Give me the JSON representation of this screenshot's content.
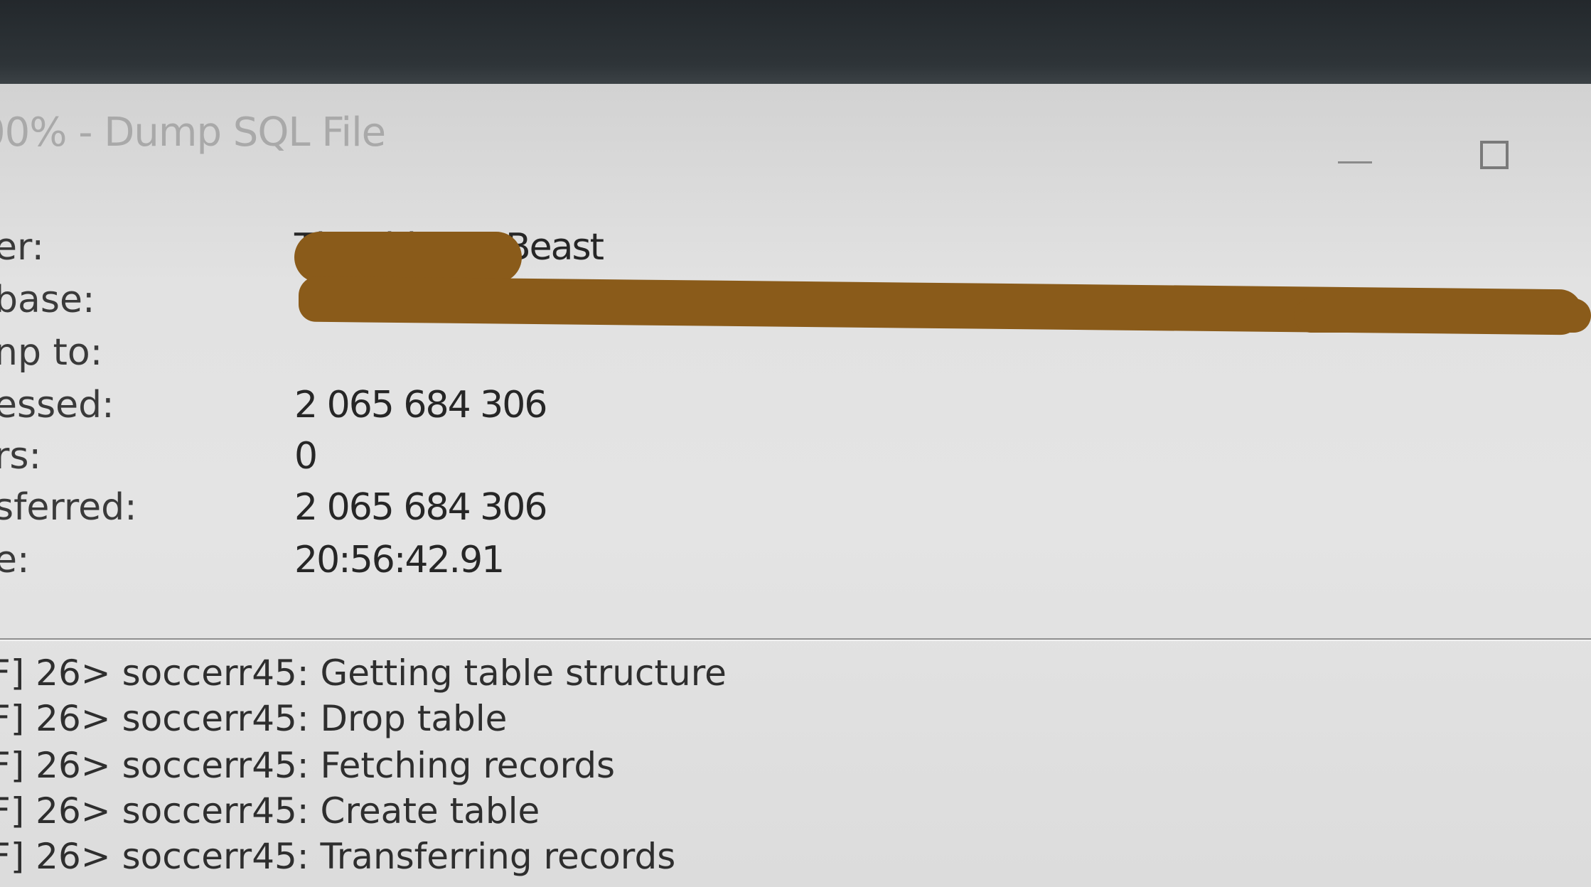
{
  "window": {
    "title": "00% - Dump SQL File"
  },
  "info": {
    "rows": [
      {
        "label": "er:",
        "value": "TheUltimateBeast"
      },
      {
        "label": "base:",
        "value": ""
      },
      {
        "label": "np to:",
        "value": ""
      },
      {
        "label": "essed:",
        "value": "2 065 684 306"
      },
      {
        "label": "rs:",
        "value": "0"
      },
      {
        "label": "sferred:",
        "value": "2 065 684 306"
      },
      {
        "label": "e:",
        "value": "20:56:42.91"
      }
    ]
  },
  "log": {
    "lines": [
      "F] 26> soccerr45: Getting table structure",
      "F] 26> soccerr45: Drop table",
      "F] 26> soccerr45: Fetching records",
      "F] 26> soccerr45: Create table",
      "F] 26> soccerr45: Transferring records"
    ]
  },
  "colors": {
    "redaction": "#8a5b1a"
  }
}
